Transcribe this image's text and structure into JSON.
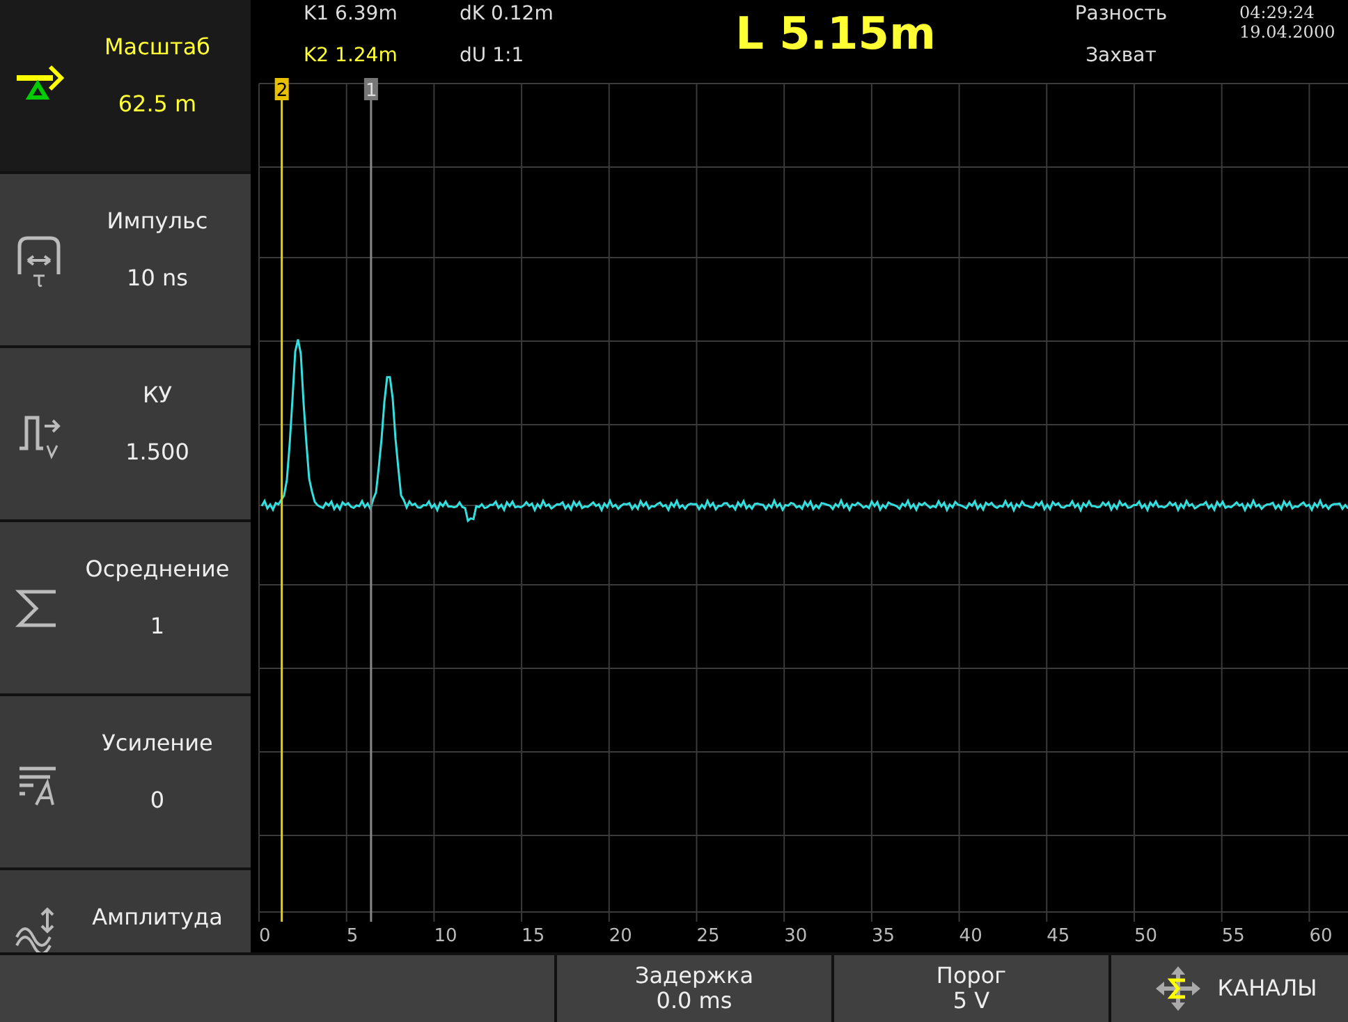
{
  "sidebar": {
    "items": [
      {
        "label": "Масштаб",
        "value": "62.5 m",
        "selected": true
      },
      {
        "label": "Импульс",
        "value": "10 ns",
        "selected": false
      },
      {
        "label": "КУ",
        "value": "1.500",
        "selected": false
      },
      {
        "label": "Осреднение",
        "value": "1",
        "selected": false
      },
      {
        "label": "Усиление",
        "value": "0",
        "selected": false
      },
      {
        "label": "Амплитуда",
        "selected": false
      }
    ]
  },
  "header": {
    "cursor_1": "K1 6.39m",
    "cursor_2": "K2 1.24m",
    "delta_k": "dK 0.12m",
    "delta_u": "dU 1:1",
    "length": "L 5.15m",
    "mode": "Разность",
    "capture": "Захват",
    "time": "04:29:24",
    "date": "19.04.2000"
  },
  "plot": {
    "cursors": [
      {
        "label": "2",
        "kind": "active"
      },
      {
        "label": "1",
        "kind": "passive"
      }
    ],
    "x_ticks": [
      "0",
      "5",
      "10",
      "15",
      "20",
      "25",
      "30",
      "35",
      "40",
      "45",
      "50",
      "55",
      "60"
    ]
  },
  "bottom_bar": [
    {
      "kind": "blank"
    },
    {
      "kind": "param",
      "label": "Задержка",
      "value": "0.0 ms"
    },
    {
      "kind": "param",
      "label": "Порог",
      "value": "5 V"
    },
    {
      "kind": "channels",
      "label": "КАНАЛЫ"
    }
  ]
}
